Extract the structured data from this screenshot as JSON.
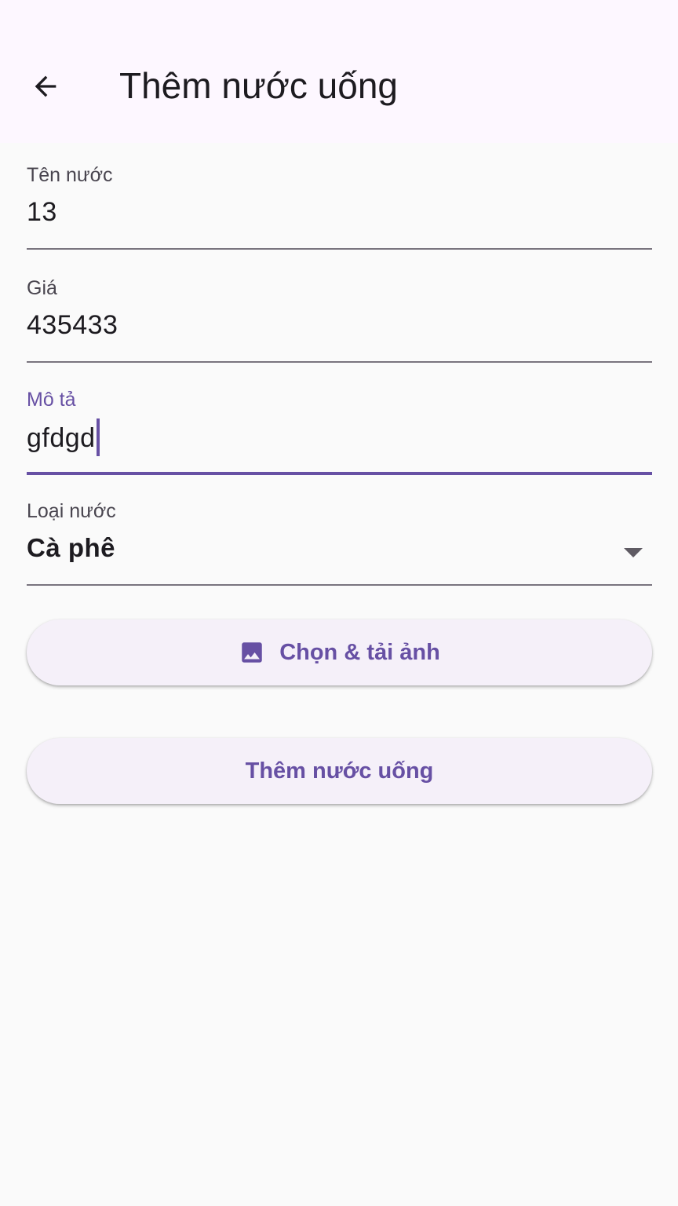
{
  "app_bar": {
    "back_icon": "arrow-back-icon",
    "title": "Thêm nước uống"
  },
  "form": {
    "name": {
      "label": "Tên nước",
      "value": "13"
    },
    "price": {
      "label": "Giá",
      "value": "435433"
    },
    "description": {
      "label": "Mô tả",
      "value": "gfdgd"
    },
    "type": {
      "label": "Loại nước",
      "value": "Cà phê",
      "icon": "dropdown-arrow-icon"
    }
  },
  "buttons": {
    "upload": {
      "label": "Chọn & tải ảnh",
      "icon": "image-icon"
    },
    "submit": {
      "label": "Thêm nước uống"
    }
  },
  "colors": {
    "accent": "#6750a4",
    "appbar_bg": "#fdf7ff",
    "body_bg": "#fafafa",
    "button_bg": "#f5f0f9",
    "text": "#1d1b20",
    "label": "#49454f"
  }
}
